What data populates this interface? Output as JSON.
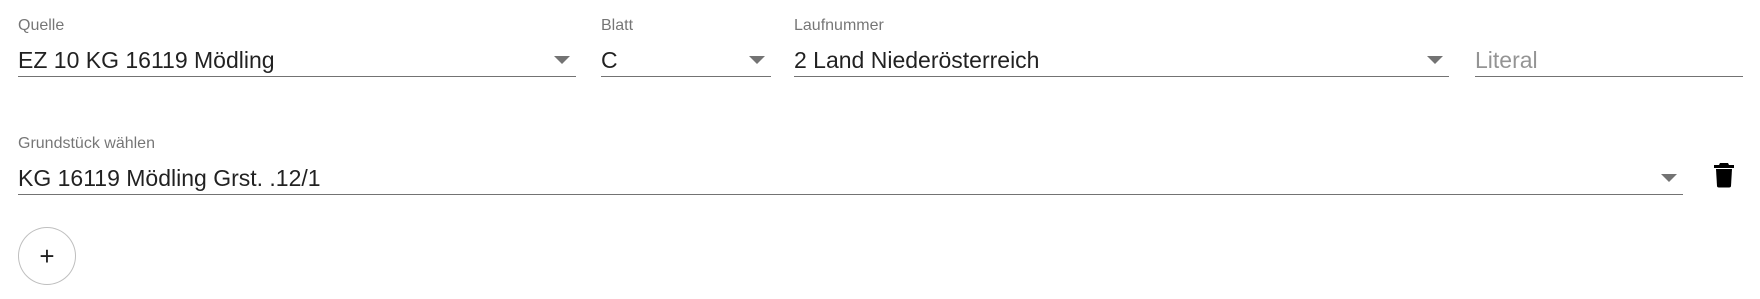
{
  "form": {
    "quelle": {
      "label": "Quelle",
      "value": "EZ 10 KG 16119 Mödling",
      "icon": "dropdown-arrow-icon"
    },
    "blatt": {
      "label": "Blatt",
      "value": "C",
      "icon": "dropdown-arrow-icon"
    },
    "laufnummer": {
      "label": "Laufnummer",
      "value": "2 Land Niederösterreich",
      "icon": "dropdown-arrow-icon"
    },
    "literal": {
      "value": "",
      "placeholder": "Literal"
    },
    "grundstueck": {
      "label": "Grundstück wählen",
      "value": "KG 16119 Mödling Grst. .12/1",
      "icon": "dropdown-arrow-icon"
    },
    "delete_button": {
      "icon": "trash-icon"
    },
    "add_button": {
      "glyph": "+",
      "icon": "plus-icon"
    }
  }
}
